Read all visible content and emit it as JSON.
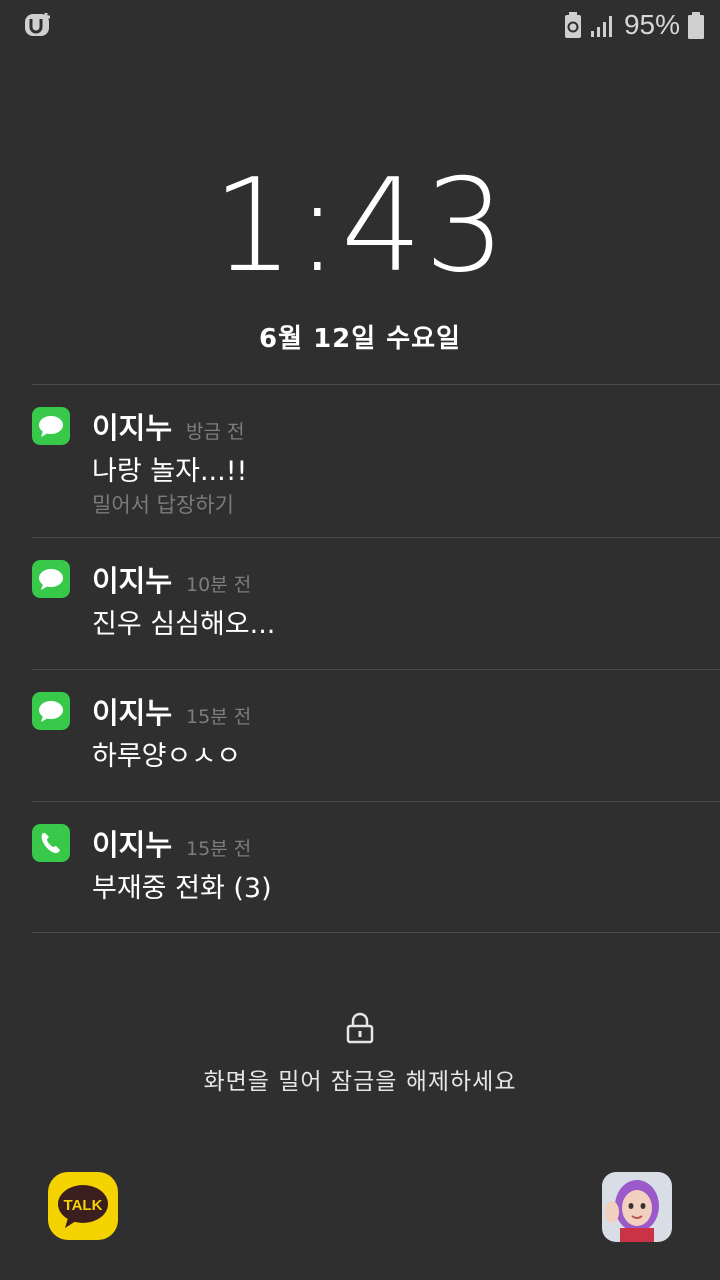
{
  "statusbar": {
    "carrier_icon": "lgu-plus-icon",
    "battery_percent": "95%",
    "icons": [
      "battery-saver-icon",
      "signal-icon",
      "battery-icon"
    ]
  },
  "lockscreen": {
    "time": "1:43",
    "date": "6월 12일 수요일",
    "unlock_hint": "화면을 밀어 잠금을 해제하세요",
    "lock_icon": "lock-icon"
  },
  "notifications": [
    {
      "app_icon": "message-icon",
      "sender": "이지누",
      "time": "방금 전",
      "message": "나랑 놀자...!!",
      "action_hint": "밀어서 답장하기"
    },
    {
      "app_icon": "message-icon",
      "sender": "이지누",
      "time": "10분 전",
      "message": "진우 심심해오..."
    },
    {
      "app_icon": "message-icon",
      "sender": "이지누",
      "time": "15분 전",
      "message": "하루양ㅇㅅㅇ"
    },
    {
      "app_icon": "phone-icon",
      "sender": "이지누",
      "time": "15분 전",
      "message": "부재중 전화 (3)"
    }
  ],
  "shortcuts": {
    "left": {
      "icon": "kakaotalk-icon",
      "label": "TALK"
    },
    "right": {
      "icon": "avatar-icon"
    }
  },
  "colors": {
    "background": "#2f2f30",
    "app_green": "#38c94a",
    "talk_yellow": "#f5d300"
  }
}
